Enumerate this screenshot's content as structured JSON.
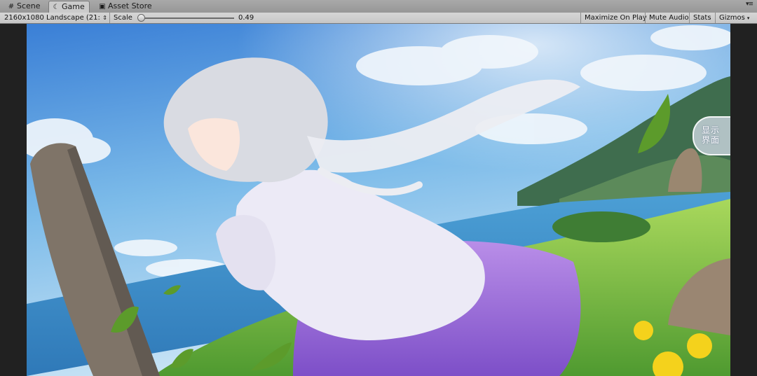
{
  "tabs": [
    {
      "label": "Scene",
      "icon": "grid-icon",
      "active": false
    },
    {
      "label": "Game",
      "icon": "pacman-icon",
      "active": true
    },
    {
      "label": "Asset Store",
      "icon": "bag-icon",
      "active": false
    }
  ],
  "toolbar": {
    "resolution": "2160x1080 Landscape (21:",
    "scale_label": "Scale",
    "scale_value": "0.49",
    "scale_fraction": 0.02,
    "maximize_on_play": "Maximize On Play",
    "mute_audio": "Mute Audio",
    "stats": "Stats",
    "gizmos": "Gizmos"
  },
  "game": {
    "show_ui_button": "显示界面"
  },
  "colors": {
    "tab_bar": "#9e9e9e",
    "toolbar": "#cdcdcd",
    "viewport_bg": "#212121"
  }
}
